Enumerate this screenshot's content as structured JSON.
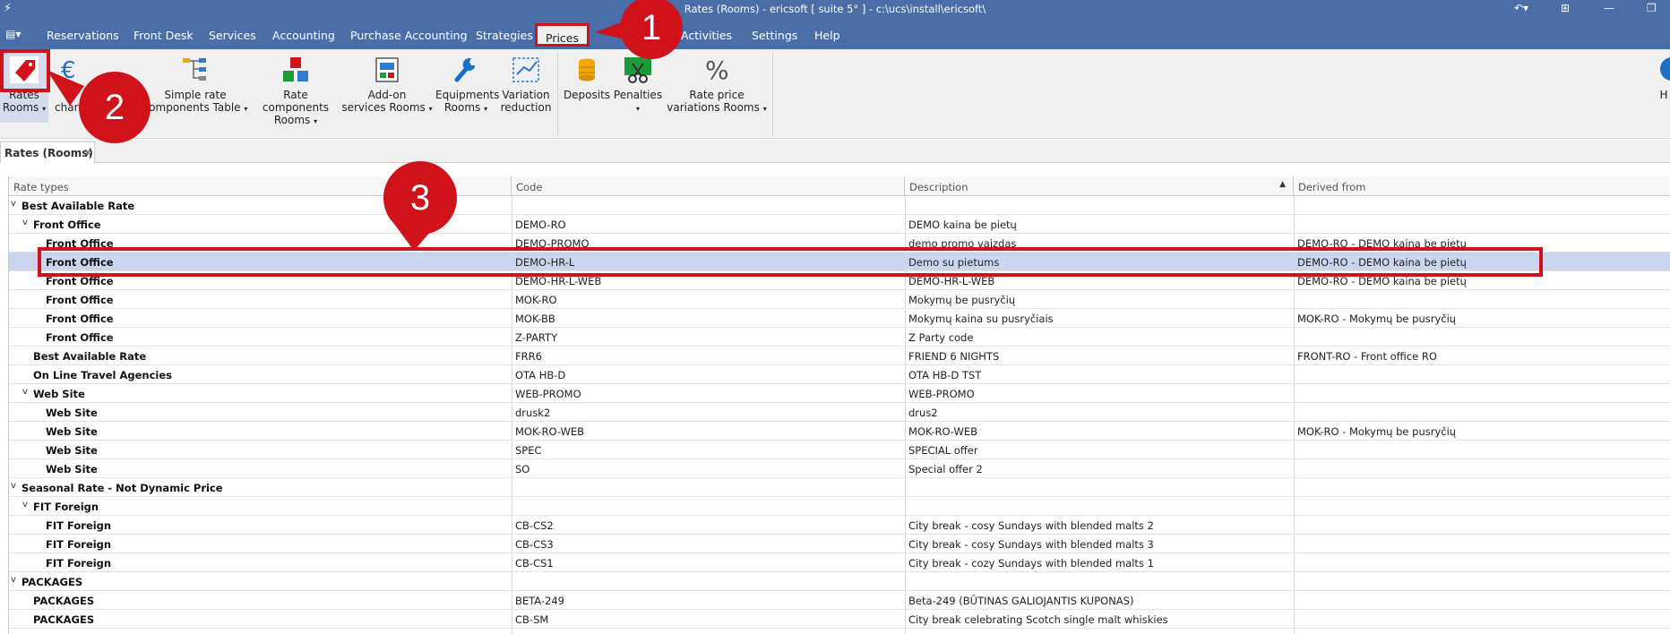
{
  "window": {
    "title": "Rates (Rooms) - ericsoft [ suite 5° ] - c:\\ucs\\install\\ericsoft\\"
  },
  "menu": {
    "items": [
      "Reservations",
      "Front Desk",
      "Services",
      "Accounting",
      "Purchase Accounting",
      "Strategies",
      "Prices",
      "Activities",
      "Settings",
      "Help"
    ],
    "active": "Prices"
  },
  "ribbon": {
    "buttons": [
      {
        "label1": "Rates",
        "label2": "Rooms",
        "icon": "price-tag-icon"
      },
      {
        "label1": "Pl",
        "label2": "charg",
        "icon": "euro-icon"
      },
      {
        "label1": "Simple rate",
        "label2": "components Table",
        "icon": "flow-icon"
      },
      {
        "label1": "Rate components",
        "label2": "Rooms",
        "icon": "blocks-icon"
      },
      {
        "label1": "Add-on",
        "label2": "services Rooms",
        "icon": "addon-icon"
      },
      {
        "label1": "Equipments",
        "label2": "Rooms",
        "icon": "wrench-icon"
      },
      {
        "label1": "Variation",
        "label2": "reduction",
        "icon": "variation-icon"
      },
      {
        "label1": "Deposits",
        "label2": "",
        "icon": "coins-icon"
      },
      {
        "label1": "Penalties",
        "label2": "",
        "icon": "scissors-icon"
      },
      {
        "label1": "Rate price",
        "label2": "variations Rooms",
        "icon": "percent-icon"
      }
    ],
    "right_label": "H"
  },
  "doc_tab": {
    "label": "Rates (Rooms)",
    "close": "×"
  },
  "grid": {
    "columns": [
      "Rate types",
      "Code",
      "Description",
      "Derived from"
    ],
    "rows": [
      {
        "level": 0,
        "exp": "v",
        "rt": "Best Available Rate",
        "code": "",
        "desc": "",
        "derived": ""
      },
      {
        "level": 1,
        "exp": "v",
        "rt": "Front Office",
        "code": "DEMO-RO",
        "desc": "DEMO kaina be pietų",
        "derived": ""
      },
      {
        "level": 2,
        "exp": "",
        "rt": "Front Office",
        "code": "DEMO-PROMO",
        "desc": "demo promo vaizdas",
        "derived": "DEMO-RO - DEMO kaina be pietų"
      },
      {
        "level": 2,
        "exp": "",
        "rt": "Front Office",
        "code": "DEMO-HR-L",
        "desc": "Demo su pietums",
        "derived": "DEMO-RO - DEMO kaina be pietų",
        "selected": true
      },
      {
        "level": 2,
        "exp": "",
        "rt": "Front Office",
        "code": "DEMO-HR-L-WEB",
        "desc": "DEMO-HR-L-WEB",
        "derived": "DEMO-RO - DEMO kaina be pietų"
      },
      {
        "level": 2,
        "exp": "",
        "rt": "Front Office",
        "code": "MOK-RO",
        "desc": "Mokymų be pusryčių",
        "derived": ""
      },
      {
        "level": 2,
        "exp": "",
        "rt": "Front Office",
        "code": "MOK-BB",
        "desc": "Mokymų kaina su pusryčiais",
        "derived": "MOK-RO - Mokymų be pusryčių"
      },
      {
        "level": 2,
        "exp": "",
        "rt": "Front Office",
        "code": "Z-PARTY",
        "desc": "Z Party code",
        "derived": ""
      },
      {
        "level": 1,
        "exp": "",
        "rt": "Best Available Rate",
        "code": "FRR6",
        "desc": "FRIEND 6 NIGHTS",
        "derived": "FRONT-RO - Front office RO"
      },
      {
        "level": 1,
        "exp": "",
        "rt": "On Line Travel Agencies",
        "code": "OTA HB-D",
        "desc": "OTA HB-D TST",
        "derived": ""
      },
      {
        "level": 1,
        "exp": "v",
        "rt": "Web Site",
        "code": "WEB-PROMO",
        "desc": "WEB-PROMO",
        "derived": ""
      },
      {
        "level": 2,
        "exp": "",
        "rt": "Web Site",
        "code": "drusk2",
        "desc": "drus2",
        "derived": ""
      },
      {
        "level": 2,
        "exp": "",
        "rt": "Web Site",
        "code": "MOK-RO-WEB",
        "desc": "MOK-RO-WEB",
        "derived": "MOK-RO - Mokymų be pusryčių"
      },
      {
        "level": 2,
        "exp": "",
        "rt": "Web Site",
        "code": "SPEC",
        "desc": "SPECIAL offer",
        "derived": ""
      },
      {
        "level": 2,
        "exp": "",
        "rt": "Web Site",
        "code": "SO",
        "desc": "Special offer 2",
        "derived": ""
      },
      {
        "level": 0,
        "exp": "v",
        "rt": "Seasonal Rate - Not Dynamic Price",
        "code": "",
        "desc": "",
        "derived": ""
      },
      {
        "level": 1,
        "exp": "v",
        "rt": "FIT Foreign",
        "code": "",
        "desc": "",
        "derived": ""
      },
      {
        "level": 2,
        "exp": "",
        "rt": "FIT Foreign",
        "code": "CB-CS2",
        "desc": "City break - cosy Sundays with blended malts 2",
        "derived": ""
      },
      {
        "level": 2,
        "exp": "",
        "rt": "FIT Foreign",
        "code": "CB-CS3",
        "desc": "City break - cosy Sundays with blended malts 3",
        "derived": ""
      },
      {
        "level": 2,
        "exp": "",
        "rt": "FIT Foreign",
        "code": "CB-CS1",
        "desc": "City break - cozy Sundays with blended malts 1",
        "derived": ""
      },
      {
        "level": 0,
        "exp": "v",
        "rt": "PACKAGES",
        "code": "",
        "desc": "",
        "derived": ""
      },
      {
        "level": 1,
        "exp": "",
        "rt": "PACKAGES",
        "code": "BETA-249",
        "desc": "Beta-249  (BŪTINAS GALIOJANTIS KUPONAS)",
        "derived": ""
      },
      {
        "level": 1,
        "exp": "",
        "rt": "PACKAGES",
        "code": "CB-SM",
        "desc": "City break celebrating Scotch single malt whiskies",
        "derived": ""
      }
    ]
  },
  "callouts": [
    "1",
    "2",
    "3"
  ],
  "colors": {
    "accent": "#4a6ea8",
    "annotation": "#d0121b",
    "selection": "#cad6ee"
  }
}
